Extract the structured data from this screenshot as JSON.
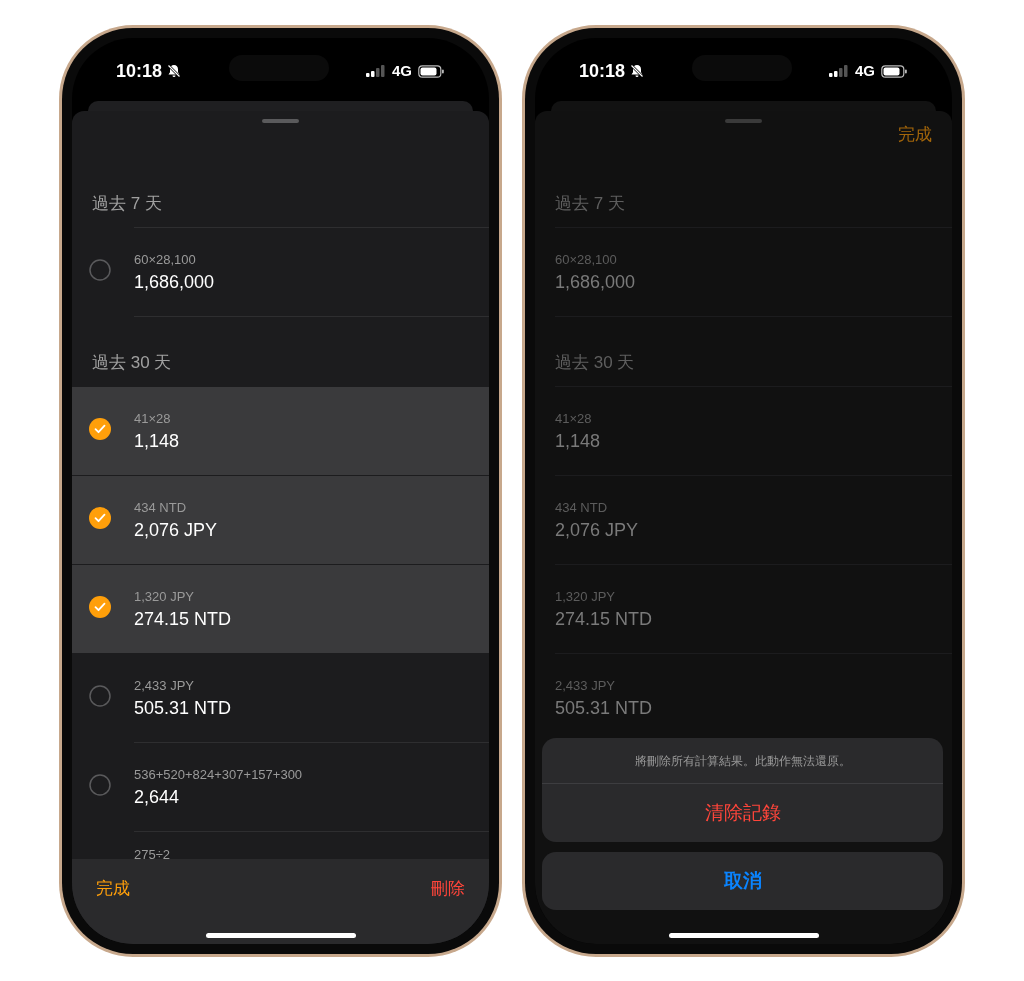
{
  "phones": [
    {
      "kind": "edit",
      "status_bar": {
        "time": "10:18",
        "network": "4G"
      },
      "sections": [
        {
          "title": "過去 7 天",
          "rows": [
            {
              "expression": "60×28,100",
              "result": "1,686,000",
              "selected": false
            }
          ]
        },
        {
          "title": "過去 30 天",
          "rows": [
            {
              "expression": "41×28",
              "result": "1,148",
              "selected": true
            },
            {
              "expression": "434 NTD",
              "result": "2,076 JPY",
              "selected": true
            },
            {
              "expression": "1,320 JPY",
              "result": "274.15 NTD",
              "selected": true
            },
            {
              "expression": "2,433 JPY",
              "result": "505.31 NTD",
              "selected": false
            },
            {
              "expression": "536+520+824+307+157+300",
              "result": "2,644",
              "selected": false
            },
            {
              "expression": "275÷2"
            }
          ]
        }
      ],
      "toolbar": {
        "done": "完成",
        "delete": "刪除"
      }
    },
    {
      "kind": "dimmed",
      "status_bar": {
        "time": "10:18",
        "network": "4G"
      },
      "done": "完成",
      "sections": [
        {
          "title": "過去 7 天",
          "rows": [
            {
              "expression": "60×28,100",
              "result": "1,686,000"
            }
          ]
        },
        {
          "title": "過去 30 天",
          "rows": [
            {
              "expression": "41×28",
              "result": "1,148"
            },
            {
              "expression": "434 NTD",
              "result": "2,076 JPY"
            },
            {
              "expression": "1,320 JPY",
              "result": "274.15 NTD"
            },
            {
              "expression": "2,433 JPY",
              "result": "505.31 NTD"
            }
          ]
        }
      ],
      "action_sheet": {
        "message": "將刪除所有計算結果。此動作無法還原。",
        "destructive": "清除記錄",
        "cancel": "取消"
      }
    }
  ]
}
